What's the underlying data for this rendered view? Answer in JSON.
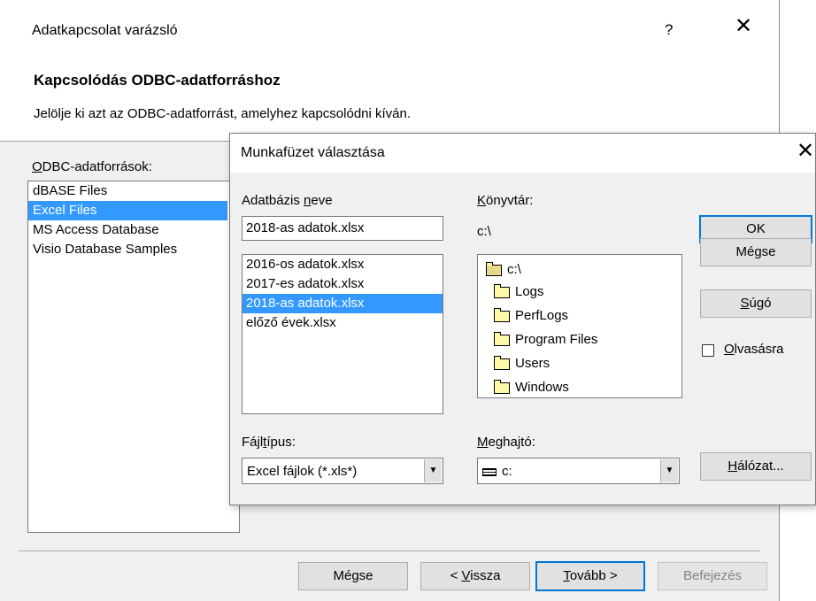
{
  "wizard": {
    "title": "Adatkapcsolat varázsló",
    "help": "?",
    "close": "✕",
    "heading": "Kapcsolódás ODBC-adatforráshoz",
    "description": "Jelölje ki azt az ODBC-adatforrást, amelyhez kapcsolódni kíván.",
    "sources_label_first": "O",
    "sources_label_rest": "DBC-adatforrások:",
    "sources": [
      "dBASE Files",
      "Excel Files",
      "MS Access Database",
      "Visio Database Samples"
    ],
    "selected_source": "Excel Files",
    "buttons": {
      "cancel": "Mégse",
      "back_prefix": "< ",
      "back_hot": "V",
      "back_rest": "issza",
      "next_hot": "T",
      "next_rest": "ovább >",
      "finish": "Befejezés"
    }
  },
  "workbook_dialog": {
    "title": "Munkafüzet választása",
    "close": "✕",
    "db_name_label_a": "Adatbázis ",
    "db_name_label_hot": "n",
    "db_name_label_b": "eve",
    "db_name_value": "2018-as adatok.xlsx",
    "files": [
      "2016-os adatok.xlsx",
      "2017-es adatok.xlsx",
      "2018-as adatok.xlsx",
      "előző évek.xlsx"
    ],
    "selected_file": "2018-as adatok.xlsx",
    "dir_label_hot": "K",
    "dir_label_rest": "önyvtár:",
    "current_dir": "c:\\",
    "dir_root": "c:\\",
    "folders": [
      "Logs",
      "PerfLogs",
      "Program Files",
      "Users",
      "Windows"
    ],
    "filetype_label_a": "Fájl",
    "filetype_label_hot": "t",
    "filetype_label_b": "ípus:",
    "filetype_value": "Excel fájlok (*.xls*)",
    "drive_label_hot": "M",
    "drive_label_rest": "eghajtó:",
    "drive_value": "c:",
    "ok": "OK",
    "cancel": "Mégse",
    "help_hot": "S",
    "help_rest": "úgó",
    "readonly_hot": "O",
    "readonly_rest": "lvasásra",
    "readonly_checked": false,
    "network_hot": "H",
    "network_rest": "álózat..."
  },
  "colors": {
    "selection": "#3399ff",
    "dialog_bg": "#f0f0f0",
    "default_button_border": "#0078d7"
  },
  "icons": {
    "folder": "folder-icon",
    "open_folder": "open-folder-icon",
    "drive": "drive-icon",
    "dropdown": "chevron-down-icon"
  }
}
